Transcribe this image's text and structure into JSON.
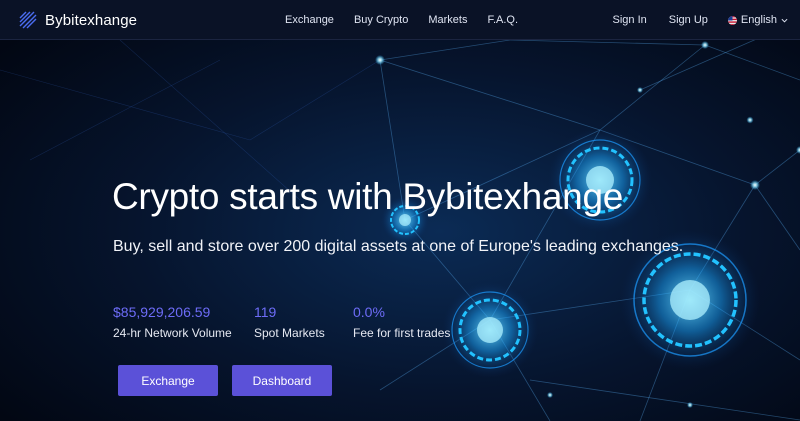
{
  "brand": {
    "name": "Bybitexhange",
    "logo_icon": "stacked-diamonds-logo"
  },
  "nav": {
    "links": [
      "Exchange",
      "Buy Crypto",
      "Markets",
      "F.A.Q."
    ],
    "sign_in": "Sign In",
    "sign_up": "Sign Up",
    "language": "English",
    "language_flag": "us-flag-icon"
  },
  "hero": {
    "headline": "Crypto starts with Bybitexhange",
    "subtitle": "Buy, sell and store over 200 digital assets at one of Europe's leading exchanges.",
    "stats": [
      {
        "value": "$85,929,206.59",
        "label": "24-hr Network Volume"
      },
      {
        "value": "119",
        "label": "Spot Markets"
      },
      {
        "value": "0.0%",
        "label": "Fee for first trades"
      }
    ],
    "buttons": {
      "primary": "Exchange",
      "secondary": "Dashboard"
    }
  },
  "colors": {
    "accent": "#5b51d8",
    "stat_value": "#6d6cf7",
    "background": "#030a1c",
    "glow": "#2ab8ff"
  }
}
